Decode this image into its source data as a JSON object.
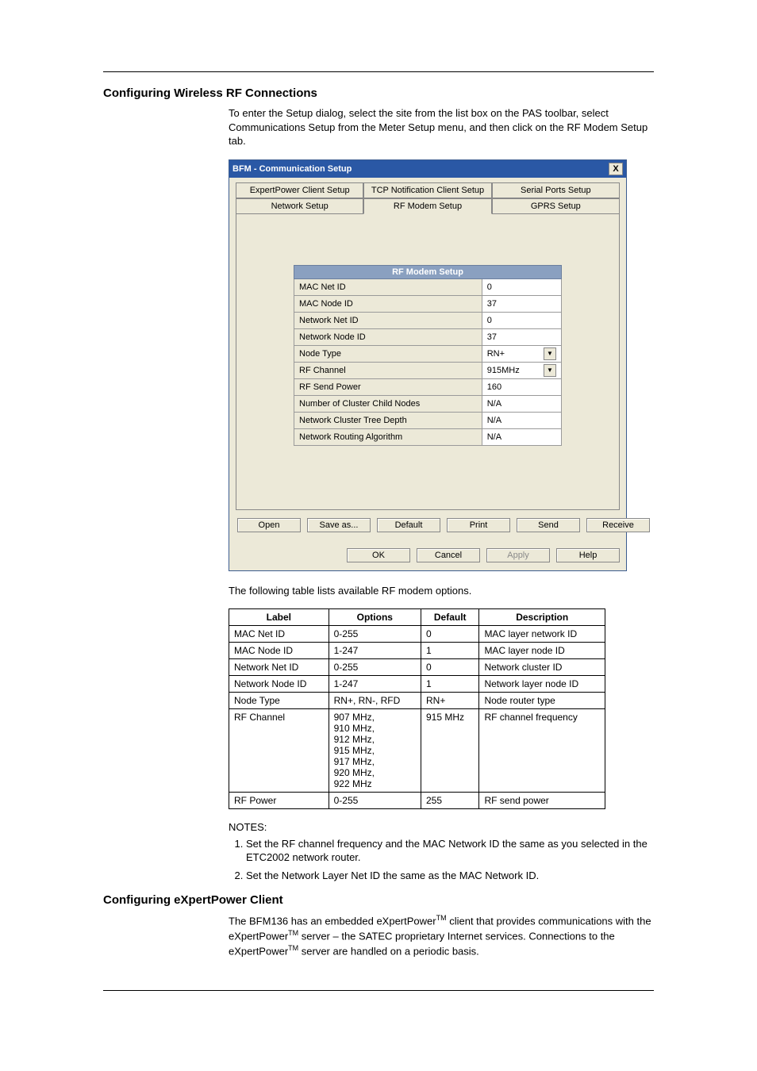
{
  "section1_title": "Configuring Wireless RF Connections",
  "section1_body": "To enter the Setup dialog, select the site from the list box on the PAS toolbar, select Communications Setup from the Meter Setup menu, and then click on the RF Modem Setup tab.",
  "dialog": {
    "title": "BFM - Communication Setup",
    "close": "X",
    "tabs_row1": [
      "ExpertPower Client Setup",
      "TCP Notification Client Setup",
      "Serial Ports Setup"
    ],
    "tabs_row2": [
      "Network Setup",
      "RF Modem Setup",
      "GPRS Setup"
    ],
    "active_tab": "RF Modem Setup",
    "rf_header": "RF Modem Setup",
    "rf_rows": [
      {
        "label": "MAC Net ID",
        "value": "0",
        "dropdown": false
      },
      {
        "label": "MAC Node ID",
        "value": "37",
        "dropdown": false
      },
      {
        "label": "Network Net ID",
        "value": "0",
        "dropdown": false
      },
      {
        "label": "Network Node ID",
        "value": "37",
        "dropdown": false
      },
      {
        "label": "Node Type",
        "value": "RN+",
        "dropdown": true
      },
      {
        "label": "RF Channel",
        "value": "915MHz",
        "dropdown": true
      },
      {
        "label": "RF Send Power",
        "value": "160",
        "dropdown": false
      },
      {
        "label": "Number of Cluster Child Nodes",
        "value": "N/A",
        "dropdown": false
      },
      {
        "label": "Network Cluster Tree Depth",
        "value": "N/A",
        "dropdown": false
      },
      {
        "label": "Network Routing Algorithm",
        "value": "N/A",
        "dropdown": false
      }
    ],
    "btns1": [
      "Open",
      "Save as...",
      "Default",
      "Print",
      "Send",
      "Receive"
    ],
    "btns2": [
      {
        "label": "OK",
        "disabled": false
      },
      {
        "label": "Cancel",
        "disabled": false
      },
      {
        "label": "Apply",
        "disabled": true
      },
      {
        "label": "Help",
        "disabled": false
      }
    ]
  },
  "post_dialog": "The following table lists available RF modem options.",
  "opts": {
    "headers": [
      "Label",
      "Options",
      "Default",
      "Description"
    ],
    "rows": [
      {
        "label": "MAC Net ID",
        "options": "0-255",
        "default": "0",
        "desc": "MAC layer network ID"
      },
      {
        "label": "MAC Node ID",
        "options": "1-247",
        "default": "1",
        "desc": "MAC layer node ID"
      },
      {
        "label": "Network Net ID",
        "options": "0-255",
        "default": "0",
        "desc": "Network cluster ID"
      },
      {
        "label": "Network Node ID",
        "options": "1-247",
        "default": "1",
        "desc": "Network layer node ID"
      },
      {
        "label": "Node Type",
        "options": "RN+, RN-, RFD",
        "default": "RN+",
        "desc": "Node router type"
      },
      {
        "label": "RF Channel",
        "options": "907 MHz,\n910 MHz,\n912 MHz,\n915 MHz,\n917 MHz,\n920 MHz,\n922 MHz",
        "default": "915 MHz",
        "desc": "RF channel frequency"
      },
      {
        "label": "RF Power",
        "options": "0-255",
        "default": "255",
        "desc": "RF send power"
      }
    ]
  },
  "notes_label": "NOTES:",
  "notes": [
    "Set the RF channel frequency and the MAC Network ID the same as you selected in the ETC2002 network router.",
    "Set the Network Layer Net ID the same as the MAC Network ID."
  ],
  "section2_title": "Configuring eXpertPower Client",
  "section2_body_parts": {
    "p1": "The BFM136  has an embedded eXpertPower",
    "tm": "TM",
    "p2": " client that provides communications with the eXpertPower",
    "p3": " server – the SATEC proprietary Internet services. Connections to the eXpertPower",
    "p4": " server are handled on a periodic basis."
  }
}
